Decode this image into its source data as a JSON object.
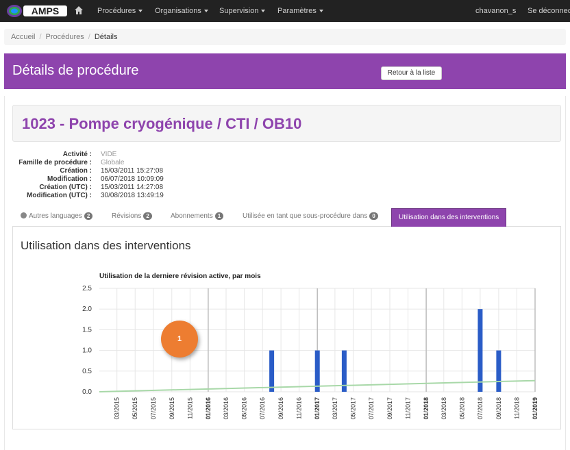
{
  "navbar": {
    "logo_text": "AMPS",
    "items": [
      {
        "label": "Procédures",
        "dropdown": true
      },
      {
        "label": "Organisations",
        "dropdown": true
      },
      {
        "label": "Supervision",
        "dropdown": true
      },
      {
        "label": "Paramètres",
        "dropdown": true
      }
    ],
    "user": "chavanon_s",
    "logout": "Se déconnec"
  },
  "breadcrumb": [
    "Accueil",
    "Procédures",
    "Détails"
  ],
  "page_header": {
    "title": "Détails de procédure",
    "back_button": "Retour à la liste"
  },
  "procedure": {
    "title": "1023 - Pompe cryogénique / CTI / OB10"
  },
  "details": [
    {
      "label": "Activité :",
      "value": "VIDE",
      "muted": true
    },
    {
      "label": "Famille de procédure :",
      "value": "Globale",
      "muted": true
    },
    {
      "label": "Création :",
      "value": "15/03/2011 15:27:08",
      "muted": false
    },
    {
      "label": "Modification :",
      "value": "06/07/2018 10:09:09",
      "muted": false
    },
    {
      "label": "Création (UTC) :",
      "value": "15/03/2011 14:27:08",
      "muted": false
    },
    {
      "label": "Modification (UTC) :",
      "value": "30/08/2018 13:49:19",
      "muted": false
    }
  ],
  "tabs": [
    {
      "label": "Autres languages",
      "badge": "2",
      "icon": "globe-icon"
    },
    {
      "label": "Révisions",
      "badge": "2"
    },
    {
      "label": "Abonnements",
      "badge": "1"
    },
    {
      "label": "Utilisée en tant que sous-procédure dans",
      "badge": "0"
    },
    {
      "label": "Utilisation dans des interventions",
      "active": true
    }
  ],
  "panel": {
    "title": "Utilisation dans des interventions"
  },
  "annotation": "1",
  "colors": {
    "navbar": "#222222",
    "accent": "#8e44ad",
    "bar": "#2a5cc7",
    "trend": "#a8d8a8",
    "annotation": "#ed7d31"
  },
  "chart_data": {
    "type": "bar",
    "title": "Utilisation de la derniere révision active, par mois",
    "ylim": [
      0,
      2.5
    ],
    "yticks": [
      "0.0",
      "0.5",
      "1.0",
      "1.5",
      "2.0",
      "2.5"
    ],
    "xticks": [
      {
        "label": "03/2015",
        "bold": false
      },
      {
        "label": "05/2015",
        "bold": false
      },
      {
        "label": "07/2015",
        "bold": false
      },
      {
        "label": "09/2015",
        "bold": false
      },
      {
        "label": "11/2015",
        "bold": false
      },
      {
        "label": "01/2016",
        "bold": true
      },
      {
        "label": "03/2016",
        "bold": false
      },
      {
        "label": "05/2016",
        "bold": false
      },
      {
        "label": "07/2016",
        "bold": false
      },
      {
        "label": "09/2016",
        "bold": false
      },
      {
        "label": "11/2016",
        "bold": false
      },
      {
        "label": "01/2017",
        "bold": true
      },
      {
        "label": "03/2017",
        "bold": false
      },
      {
        "label": "05/2017",
        "bold": false
      },
      {
        "label": "07/2017",
        "bold": false
      },
      {
        "label": "09/2017",
        "bold": false
      },
      {
        "label": "11/2017",
        "bold": false
      },
      {
        "label": "01/2018",
        "bold": true
      },
      {
        "label": "03/2018",
        "bold": false
      },
      {
        "label": "05/2018",
        "bold": false
      },
      {
        "label": "07/2018",
        "bold": false
      },
      {
        "label": "09/2018",
        "bold": false
      },
      {
        "label": "11/2018",
        "bold": false
      },
      {
        "label": "01/2019",
        "bold": true
      }
    ],
    "bars": [
      {
        "month": "2016-08",
        "value": 1
      },
      {
        "month": "2017-01",
        "value": 1
      },
      {
        "month": "2017-04",
        "value": 1
      },
      {
        "month": "2018-07",
        "value": 2
      },
      {
        "month": "2018-09",
        "value": 1
      }
    ],
    "trend": {
      "start": {
        "month": "2015-01",
        "value": 0
      },
      "end": {
        "month": "2019-01",
        "value": 0.27
      }
    }
  }
}
